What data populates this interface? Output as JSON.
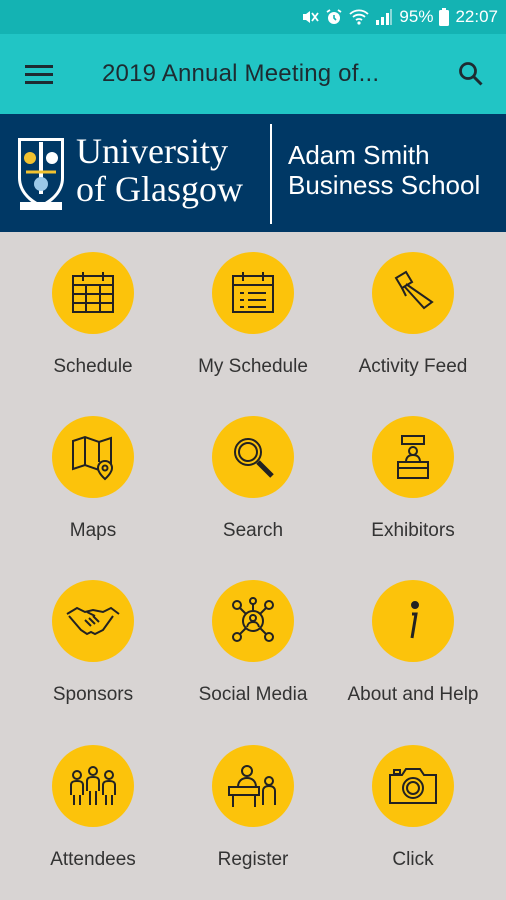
{
  "status": {
    "battery": "95%",
    "time": "22:07"
  },
  "app_bar": {
    "title": "2019 Annual Meeting of..."
  },
  "banner": {
    "university_line1": "University",
    "university_line2": "of Glasgow",
    "school_line1": "Adam Smith",
    "school_line2": "Business School"
  },
  "tiles": [
    {
      "label": "Schedule",
      "icon": "calendar-icon"
    },
    {
      "label": "My Schedule",
      "icon": "calendar-list-icon"
    },
    {
      "label": "Activity Feed",
      "icon": "megaphone-icon"
    },
    {
      "label": "Maps",
      "icon": "map-icon"
    },
    {
      "label": "Search",
      "icon": "search-icon"
    },
    {
      "label": "Exhibitors",
      "icon": "exhibitor-booth-icon"
    },
    {
      "label": "Sponsors",
      "icon": "handshake-icon"
    },
    {
      "label": "Social Media",
      "icon": "social-network-icon"
    },
    {
      "label": "About and Help",
      "icon": "info-icon"
    },
    {
      "label": "Attendees",
      "icon": "people-icon"
    },
    {
      "label": "Register",
      "icon": "registration-desk-icon"
    },
    {
      "label": "Click",
      "icon": "camera-icon"
    }
  ],
  "colors": {
    "status_bar": "#14b3b3",
    "app_bar": "#21c5c5",
    "banner": "#003865",
    "tile_circle": "#fcc30b",
    "background": "#d8d4d3"
  }
}
